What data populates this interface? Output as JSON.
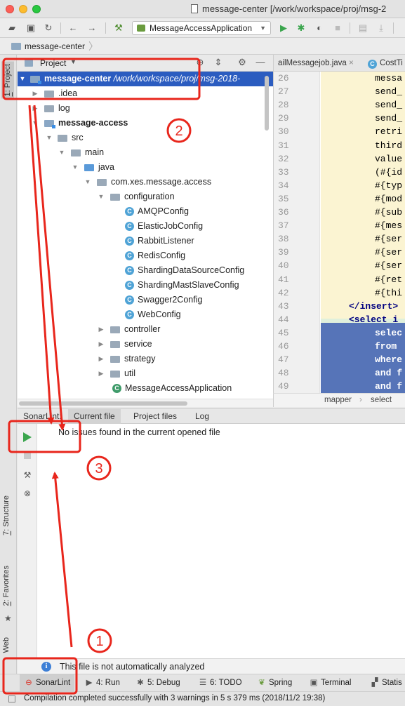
{
  "window": {
    "title": "message-center [/work/workspace/proj/msg-2"
  },
  "toolbar": {
    "run_config": "MessageAccessApplication"
  },
  "navbar": {
    "project": "message-center"
  },
  "left_stripe": {
    "project_tab_num": "1",
    "project_tab": "Project",
    "structure_tab_num": "7",
    "structure_tab": "Structure",
    "favorites_tab_num": "2",
    "favorites_tab": "Favorites",
    "web_tab": "Web"
  },
  "project_panel": {
    "title": "Project",
    "tree": [
      {
        "label": "message-center",
        "path": " /work/workspace/proj/msg-2018-",
        "selected": true
      },
      {
        "label": ".idea"
      },
      {
        "label": "log"
      },
      {
        "label": "message-access"
      },
      {
        "label": "src"
      },
      {
        "label": "main"
      },
      {
        "label": "java"
      },
      {
        "label": "com.xes.message.access"
      },
      {
        "label": "configuration"
      },
      {
        "label": "AMQPConfig"
      },
      {
        "label": "ElasticJobConfig"
      },
      {
        "label": "RabbitListener"
      },
      {
        "label": "RedisConfig"
      },
      {
        "label": "ShardingDataSourceConfig"
      },
      {
        "label": "ShardingMastSlaveConfig"
      },
      {
        "label": "Swagger2Config"
      },
      {
        "label": "WebConfig"
      },
      {
        "label": "controller"
      },
      {
        "label": "service"
      },
      {
        "label": "strategy"
      },
      {
        "label": "util"
      },
      {
        "label": "MessageAccessApplication"
      }
    ]
  },
  "editor": {
    "tabs": [
      {
        "label": "ailMessagejob.java"
      },
      {
        "label": "CostTi"
      }
    ],
    "tab_close": "×",
    "class_glyph": "C",
    "lines": [
      {
        "num": "26",
        "code": "messa"
      },
      {
        "num": "27",
        "code": "send_"
      },
      {
        "num": "28",
        "code": "send_"
      },
      {
        "num": "29",
        "code": "send_"
      },
      {
        "num": "30",
        "code": "retri"
      },
      {
        "num": "31",
        "code": "third"
      },
      {
        "num": "32",
        "code": "value"
      },
      {
        "num": "33",
        "code": "(#{id"
      },
      {
        "num": "34",
        "code": "#{typ"
      },
      {
        "num": "35",
        "code": "#{mod"
      },
      {
        "num": "36",
        "code": "#{sub"
      },
      {
        "num": "37",
        "code": "#{mes"
      },
      {
        "num": "38",
        "code": "#{ser"
      },
      {
        "num": "39",
        "code": "#{ser"
      },
      {
        "num": "40",
        "code": "#{ser"
      },
      {
        "num": "41",
        "code": "#{ret"
      },
      {
        "num": "42",
        "code": "#{thi"
      },
      {
        "num": "43",
        "code": "</insert>"
      },
      {
        "num": "44",
        "code": "<select i"
      },
      {
        "num": "45",
        "code": "selec"
      },
      {
        "num": "46",
        "code": "from"
      },
      {
        "num": "47",
        "code": "where"
      },
      {
        "num": "48",
        "code": "and f"
      },
      {
        "num": "49",
        "code": "and f"
      }
    ],
    "breadcrumb": [
      "mapper",
      "select"
    ],
    "breadcrumb_sep": "›"
  },
  "sonarlint": {
    "prefix": "SonarLint:",
    "tabs": [
      "Current file",
      "Project files",
      "Log"
    ],
    "message": "No issues found in the current opened file"
  },
  "info_bar": {
    "icon": "i",
    "text": "This file is not automatically analyzed"
  },
  "bottom_tabs": [
    {
      "label": "SonarLint",
      "icon": "sonar-icon"
    },
    {
      "label": "4: Run",
      "icon": "run-icon"
    },
    {
      "label": "5: Debug",
      "icon": "debug-icon"
    },
    {
      "label": "6: TODO",
      "icon": "todo-icon"
    },
    {
      "label": "Spring",
      "icon": "spring-icon"
    },
    {
      "label": "Terminal",
      "icon": "terminal-icon"
    },
    {
      "label": "Statis",
      "icon": "statistic-icon"
    }
  ],
  "status": {
    "text": "Compilation completed successfully with 3 warnings in 5 s 379 ms (2018/11/2 19:38)"
  },
  "annotations": {
    "labels": [
      "1",
      "2",
      "3"
    ],
    "color": "#e8261c"
  },
  "colors": {
    "selection": "#2b5cc0",
    "run_green": "#3aa54d",
    "annotation_red": "#e8261c"
  }
}
